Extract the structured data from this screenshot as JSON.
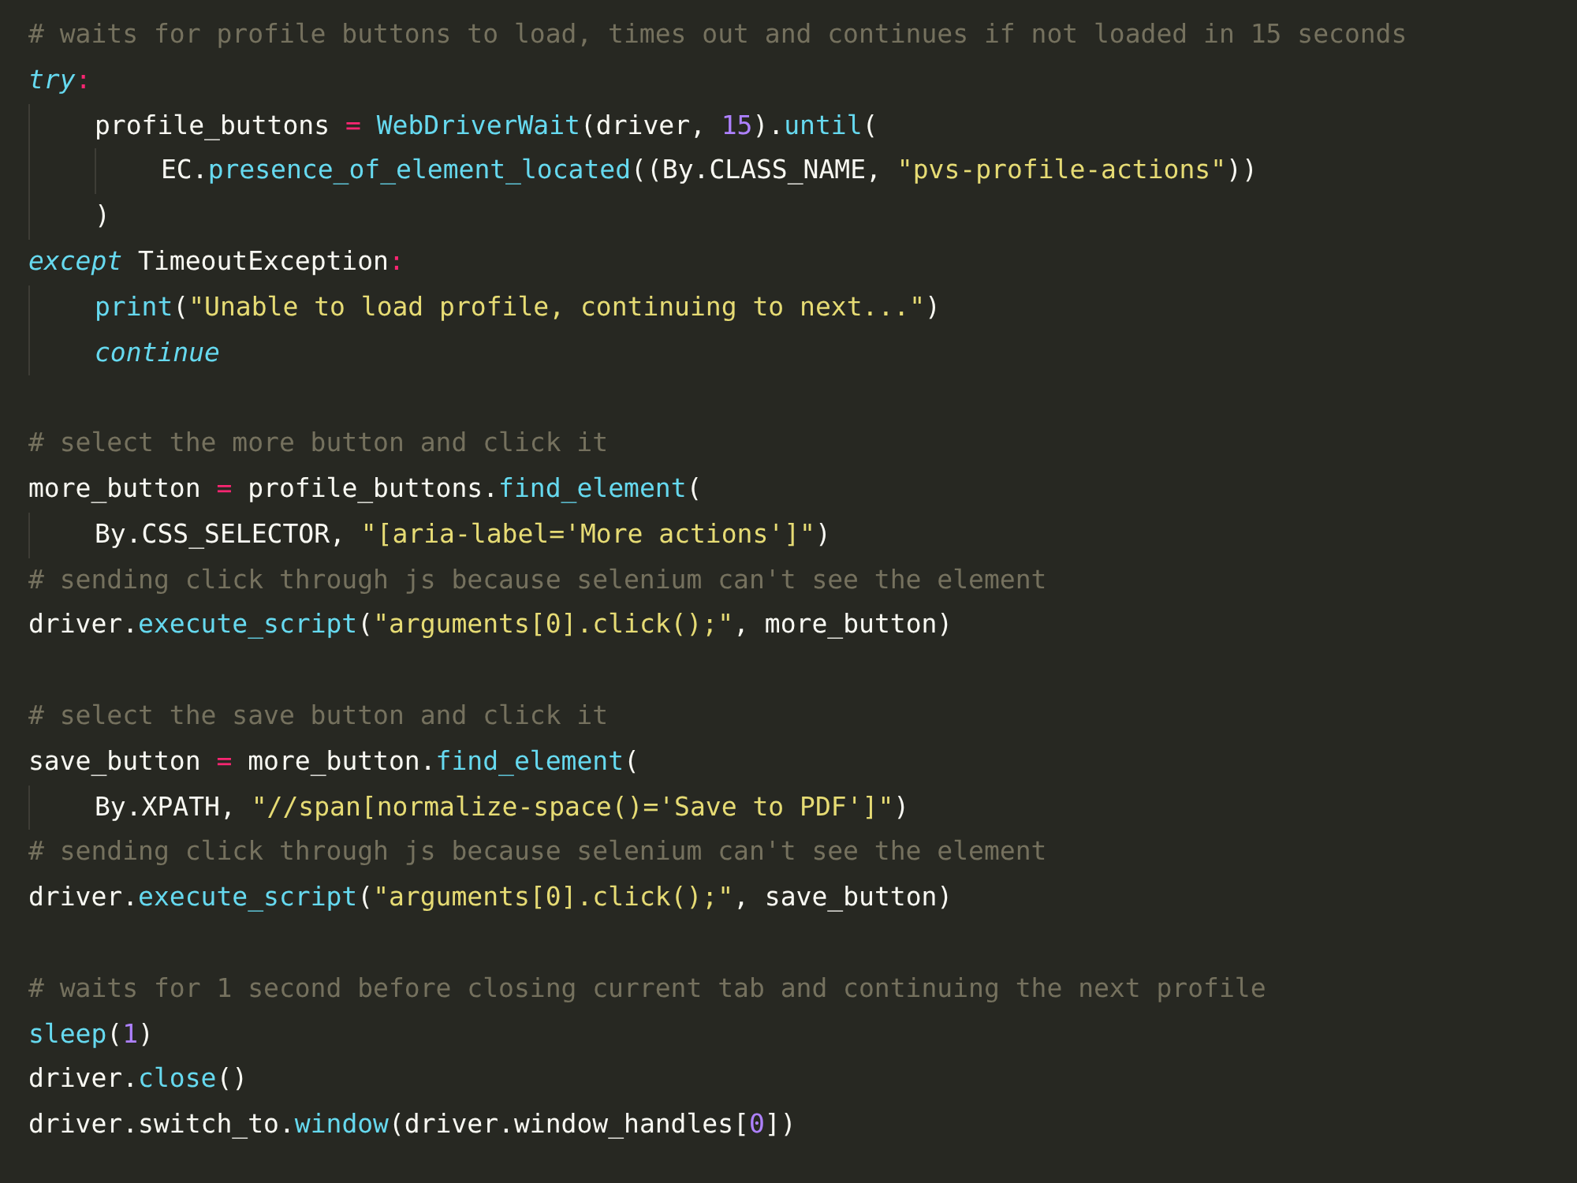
{
  "editor": {
    "lines": [
      {
        "kind": "code",
        "tokens": [
          {
            "kind": "comment",
            "text": "# waits for profile buttons to load, times out and continues if not loaded in 15 seconds"
          }
        ]
      },
      {
        "kind": "code",
        "tokens": [
          {
            "kind": "keyword",
            "text": "try"
          },
          {
            "kind": "operator",
            "text": ":"
          }
        ],
        "children": [
          {
            "kind": "code",
            "tokens": [
              {
                "kind": "plain",
                "text": "profile_buttons "
              },
              {
                "kind": "operator",
                "text": "= "
              },
              {
                "kind": "function",
                "text": "WebDriverWait"
              },
              {
                "kind": "plain",
                "text": "(driver, "
              },
              {
                "kind": "number",
                "text": "15"
              },
              {
                "kind": "plain",
                "text": ")."
              },
              {
                "kind": "function",
                "text": "until"
              },
              {
                "kind": "plain",
                "text": "("
              }
            ],
            "children": [
              {
                "kind": "code",
                "tokens": [
                  {
                    "kind": "plain",
                    "text": "EC."
                  },
                  {
                    "kind": "function",
                    "text": "presence_of_element_located"
                  },
                  {
                    "kind": "plain",
                    "text": "((By.CLASS_NAME, "
                  },
                  {
                    "kind": "string",
                    "text": "\"pvs-profile-actions\""
                  },
                  {
                    "kind": "plain",
                    "text": "))"
                  }
                ]
              }
            ]
          },
          {
            "kind": "code",
            "tokens": [
              {
                "kind": "plain",
                "text": ")"
              }
            ]
          }
        ]
      },
      {
        "kind": "code",
        "tokens": [
          {
            "kind": "keyword",
            "text": "except"
          },
          {
            "kind": "plain",
            "text": " TimeoutException"
          },
          {
            "kind": "operator",
            "text": ":"
          }
        ],
        "children": [
          {
            "kind": "code",
            "tokens": [
              {
                "kind": "function",
                "text": "print"
              },
              {
                "kind": "plain",
                "text": "("
              },
              {
                "kind": "string",
                "text": "\"Unable to load profile, continuing to next...\""
              },
              {
                "kind": "plain",
                "text": ")"
              }
            ]
          },
          {
            "kind": "code",
            "tokens": [
              {
                "kind": "keyword",
                "text": "continue"
              }
            ]
          }
        ]
      },
      {
        "kind": "blank"
      },
      {
        "kind": "code",
        "tokens": [
          {
            "kind": "comment",
            "text": "# select the more button and click it"
          }
        ]
      },
      {
        "kind": "code",
        "tokens": [
          {
            "kind": "plain",
            "text": "more_button "
          },
          {
            "kind": "operator",
            "text": "="
          },
          {
            "kind": "plain",
            "text": " profile_buttons."
          },
          {
            "kind": "function",
            "text": "find_element"
          },
          {
            "kind": "plain",
            "text": "("
          }
        ],
        "children": [
          {
            "kind": "code",
            "tokens": [
              {
                "kind": "plain",
                "text": "By.CSS_SELECTOR, "
              },
              {
                "kind": "string",
                "text": "\"[aria-label='More actions']\""
              },
              {
                "kind": "plain",
                "text": ")"
              }
            ]
          }
        ]
      },
      {
        "kind": "code",
        "tokens": [
          {
            "kind": "comment",
            "text": "# sending click through js because selenium can't see the element"
          }
        ]
      },
      {
        "kind": "code",
        "tokens": [
          {
            "kind": "plain",
            "text": "driver."
          },
          {
            "kind": "function",
            "text": "execute_script"
          },
          {
            "kind": "plain",
            "text": "("
          },
          {
            "kind": "string",
            "text": "\"arguments[0].click();\""
          },
          {
            "kind": "plain",
            "text": ", more_button)"
          }
        ]
      },
      {
        "kind": "blank"
      },
      {
        "kind": "code",
        "tokens": [
          {
            "kind": "comment",
            "text": "# select the save button and click it"
          }
        ]
      },
      {
        "kind": "code",
        "tokens": [
          {
            "kind": "plain",
            "text": "save_button "
          },
          {
            "kind": "operator",
            "text": "="
          },
          {
            "kind": "plain",
            "text": " more_button."
          },
          {
            "kind": "function",
            "text": "find_element"
          },
          {
            "kind": "plain",
            "text": "("
          }
        ],
        "children": [
          {
            "kind": "code",
            "tokens": [
              {
                "kind": "plain",
                "text": "By.XPATH, "
              },
              {
                "kind": "string",
                "text": "\"//span[normalize-space()='Save to PDF']\""
              },
              {
                "kind": "plain",
                "text": ")"
              }
            ]
          }
        ]
      },
      {
        "kind": "code",
        "tokens": [
          {
            "kind": "comment",
            "text": "# sending click through js because selenium can't see the element"
          }
        ]
      },
      {
        "kind": "code",
        "tokens": [
          {
            "kind": "plain",
            "text": "driver."
          },
          {
            "kind": "function",
            "text": "execute_script"
          },
          {
            "kind": "plain",
            "text": "("
          },
          {
            "kind": "string",
            "text": "\"arguments[0].click();\""
          },
          {
            "kind": "plain",
            "text": ", save_button)"
          }
        ]
      },
      {
        "kind": "blank"
      },
      {
        "kind": "code",
        "tokens": [
          {
            "kind": "comment",
            "text": "# waits for 1 second before closing current tab and continuing the next profile"
          }
        ]
      },
      {
        "kind": "code",
        "tokens": [
          {
            "kind": "function",
            "text": "sleep"
          },
          {
            "kind": "plain",
            "text": "("
          },
          {
            "kind": "number",
            "text": "1"
          },
          {
            "kind": "plain",
            "text": ")"
          }
        ]
      },
      {
        "kind": "code",
        "tokens": [
          {
            "kind": "plain",
            "text": "driver."
          },
          {
            "kind": "function",
            "text": "close"
          },
          {
            "kind": "plain",
            "text": "()"
          }
        ]
      },
      {
        "kind": "code",
        "tokens": [
          {
            "kind": "plain",
            "text": "driver.switch_to."
          },
          {
            "kind": "function",
            "text": "window"
          },
          {
            "kind": "plain",
            "text": "(driver.window_handles["
          },
          {
            "kind": "number",
            "text": "0"
          },
          {
            "kind": "plain",
            "text": "])"
          }
        ]
      }
    ]
  }
}
